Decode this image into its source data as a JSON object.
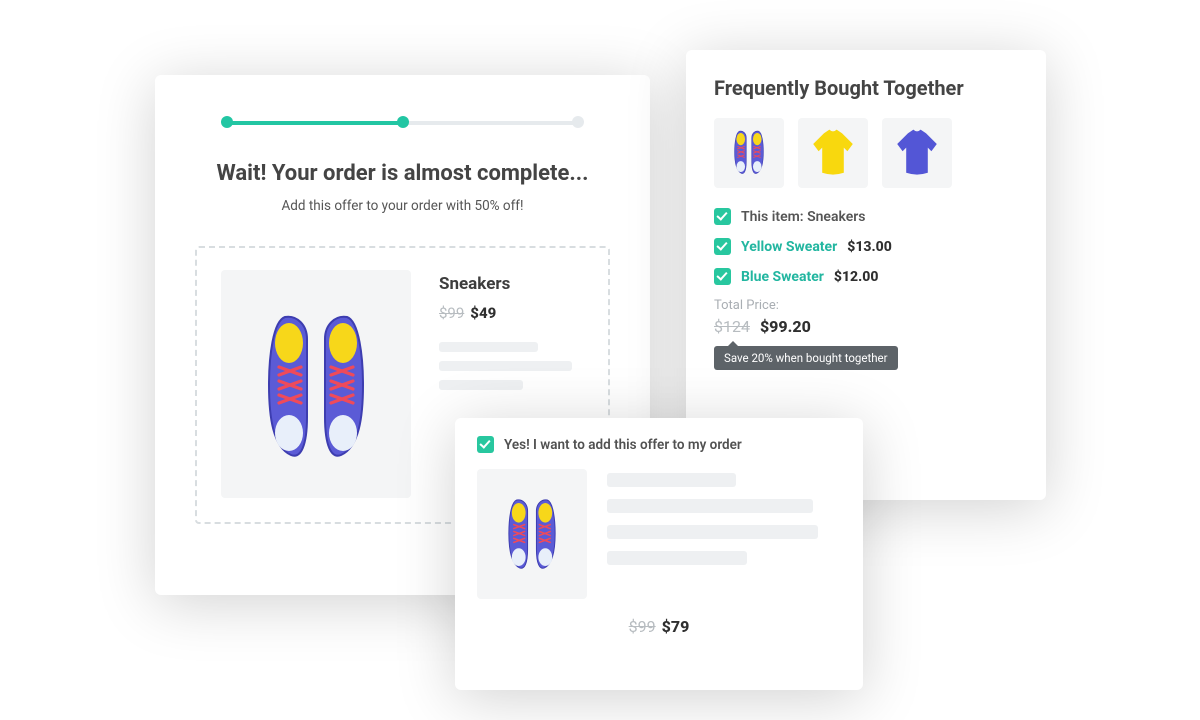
{
  "upsell": {
    "title": "Wait! Your order is almost complete...",
    "subtitle": "Add this offer to your order with 50% off!",
    "product": {
      "name": "Sneakers",
      "old_price": "$99",
      "price": "$49"
    }
  },
  "fbt": {
    "title": "Frequently Bought Together",
    "items": [
      {
        "label": "This item: Sneakers",
        "is_link": false,
        "price": ""
      },
      {
        "label": "Yellow Sweater",
        "is_link": true,
        "price": "$13.00"
      },
      {
        "label": "Blue Sweater",
        "is_link": true,
        "price": "$12.00"
      }
    ],
    "total_label": "Total Price:",
    "total_old": "$124",
    "total_new": "$99.20",
    "save_text": "Save 20% when bought together"
  },
  "confirm": {
    "text": "Yes! I want to add this offer to my order",
    "old_price": "$99",
    "price": "$79"
  }
}
